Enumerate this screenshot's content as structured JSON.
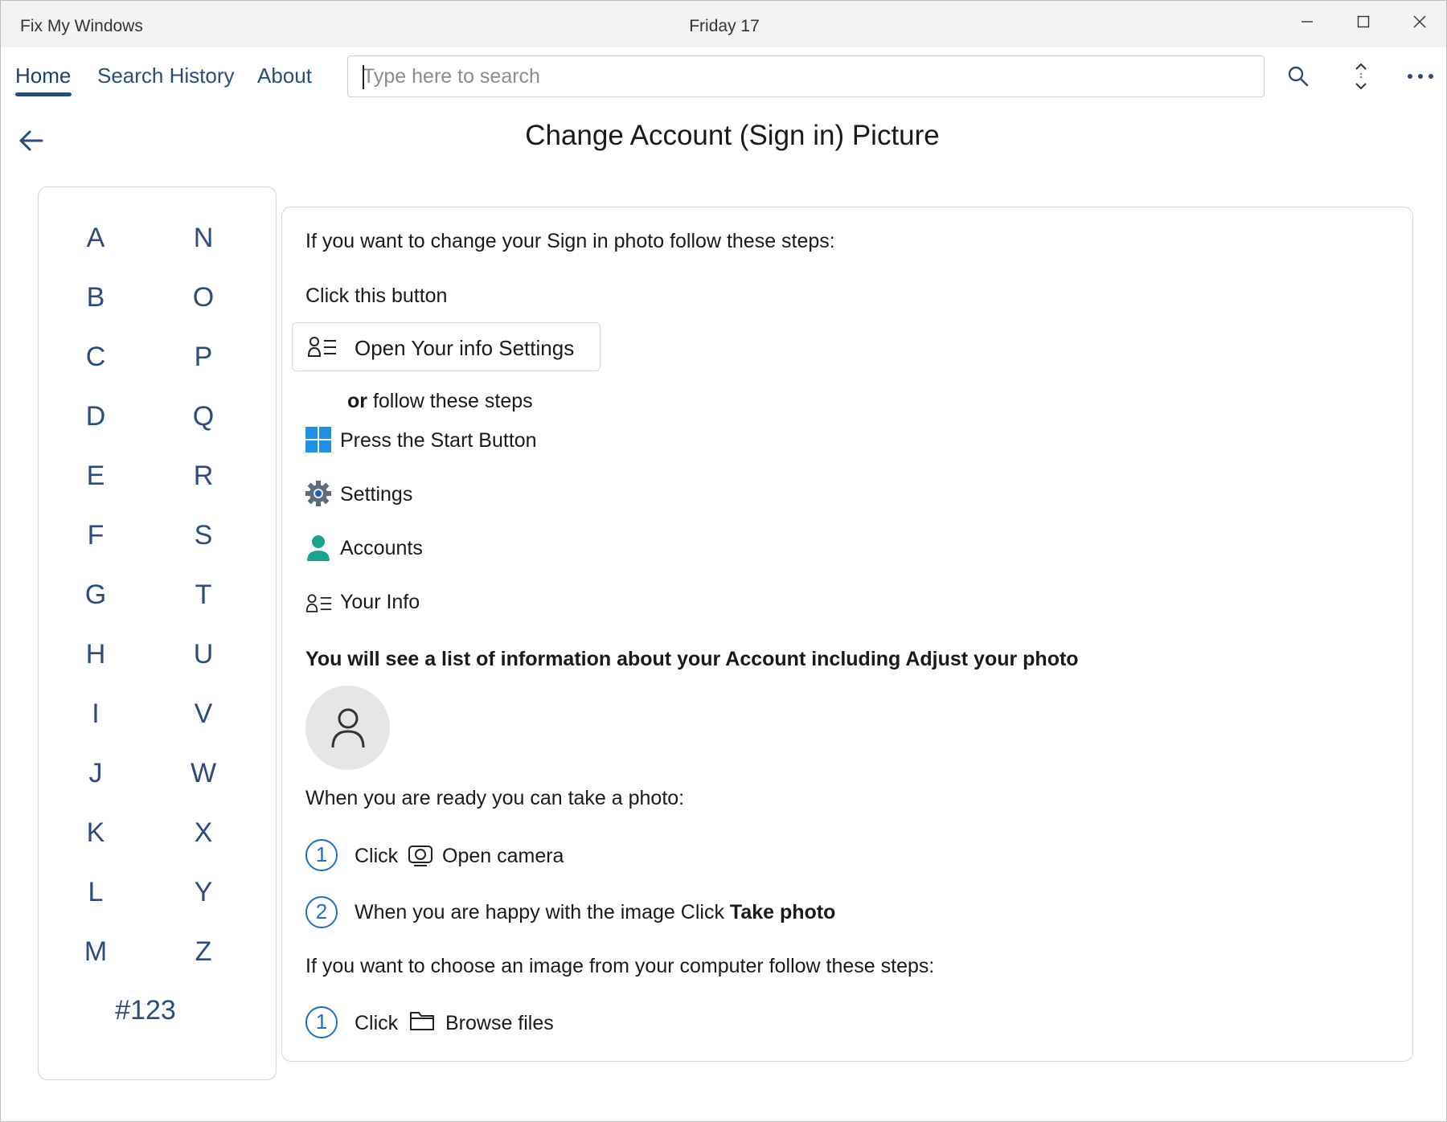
{
  "window": {
    "app_title": "Fix My Windows",
    "date_title": "Friday 17"
  },
  "nav": {
    "home": "Home",
    "search_history": "Search History",
    "about": "About"
  },
  "search": {
    "placeholder": "Type here to search",
    "value": ""
  },
  "page": {
    "title": "Change Account (Sign in) Picture"
  },
  "alphabet": {
    "left_column": [
      "A",
      "B",
      "C",
      "D",
      "E",
      "F",
      "G",
      "H",
      "I",
      "J",
      "K",
      "L",
      "M"
    ],
    "right_column": [
      "N",
      "O",
      "P",
      "Q",
      "R",
      "S",
      "T",
      "U",
      "V",
      "W",
      "X",
      "Y",
      "Z"
    ],
    "numbers": "#123"
  },
  "content": {
    "intro": "If you want to change your Sign in photo follow these steps:",
    "click_this_button": "Click this button",
    "open_settings_button": "Open Your info Settings",
    "or_label": "or",
    "follow_steps": " follow these steps",
    "steps": [
      "Press the Start Button",
      "Settings",
      "Accounts",
      "Your Info"
    ],
    "list_info": "You will see a list of information about your Account including Adjust your photo",
    "ready_photo": "When you are ready you can take a photo:",
    "photo_steps": {
      "one_number": "1",
      "one_click": "Click",
      "one_action": "Open camera",
      "two_number": "2",
      "two_text": "When you are happy with the image Click ",
      "two_bold": "Take photo"
    },
    "choose_image": "If you want to choose an image from your computer follow these steps:",
    "browse_steps": {
      "one_number": "1",
      "one_click": "Click",
      "one_action": "Browse files"
    }
  },
  "colors": {
    "accent": "#1f4f8d",
    "link": "#2b4c7e",
    "step_number": "#1a73c8",
    "accounts_icon": "#1aa38f",
    "titlebar": "#f3f3f3"
  },
  "icons": {
    "back": "arrow-left-icon",
    "search": "search-icon",
    "expand": "expand-collapse-icon",
    "more": "more-dots-icon",
    "your_info": "contact-card-icon",
    "start": "windows-start-icon",
    "settings": "settings-gear-icon",
    "accounts": "person-accounts-icon",
    "avatar": "person-outline-icon",
    "camera": "camera-icon",
    "folder": "folder-icon"
  }
}
